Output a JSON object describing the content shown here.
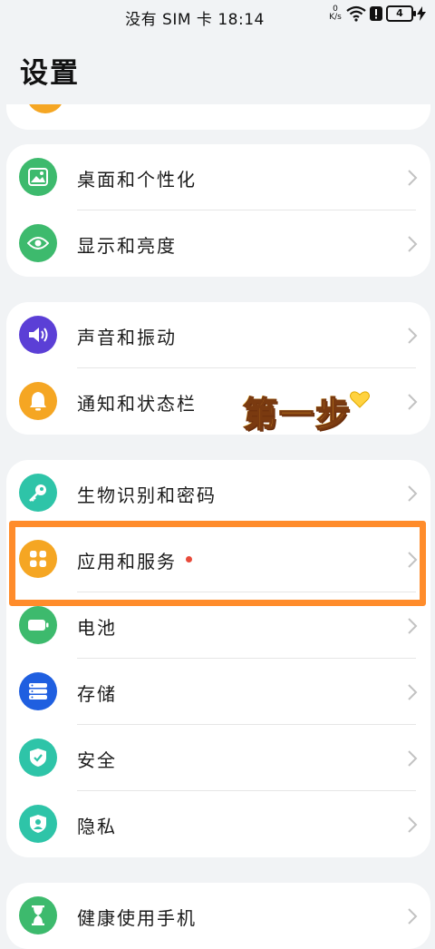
{
  "status_bar": {
    "carrier": "没有 SIM 卡",
    "time": "18:14",
    "net_speed_value": "0",
    "net_speed_unit": "K/s",
    "battery": "4"
  },
  "page": {
    "title": "设置"
  },
  "groups": [
    {
      "items": [
        {
          "label": "桌面和个性化",
          "icon": "image-icon",
          "color": "#3dba6d"
        },
        {
          "label": "显示和亮度",
          "icon": "eye-icon",
          "color": "#3dba6d"
        }
      ]
    },
    {
      "items": [
        {
          "label": "声音和振动",
          "icon": "speaker-icon",
          "color": "#5b3fd6"
        },
        {
          "label": "通知和状态栏",
          "icon": "bell-icon",
          "color": "#f5a623"
        }
      ]
    },
    {
      "items": [
        {
          "label": "生物识别和密码",
          "icon": "key-icon",
          "color": "#2ec4a8"
        },
        {
          "label": "应用和服务",
          "icon": "apps-grid-icon",
          "color": "#f5a623"
        },
        {
          "label": "电池",
          "icon": "battery-icon",
          "color": "#3dba6d"
        },
        {
          "label": "存储",
          "icon": "storage-icon",
          "color": "#1f5fe0"
        },
        {
          "label": "安全",
          "icon": "shield-check-icon",
          "color": "#2ec4a8"
        },
        {
          "label": "隐私",
          "icon": "privacy-shield-icon",
          "color": "#2ec4a8"
        }
      ]
    },
    {
      "items": [
        {
          "label": "健康使用手机",
          "icon": "hourglass-icon",
          "color": "#3dba6d"
        }
      ]
    }
  ],
  "annotation": {
    "sticker_text": "第一步",
    "highlight_color": "#ff8c2b"
  }
}
